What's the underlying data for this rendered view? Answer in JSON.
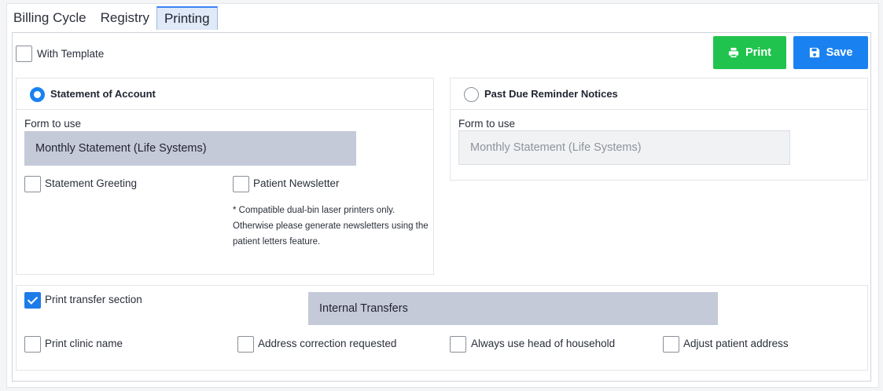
{
  "tabs": [
    {
      "label": "Billing Cycle",
      "active": false
    },
    {
      "label": "Registry",
      "active": false
    },
    {
      "label": "Printing",
      "active": true
    }
  ],
  "toolbar": {
    "with_template_label": "With Template",
    "with_template_checked": false,
    "print_label": "Print",
    "save_label": "Save"
  },
  "statement": {
    "radio_label": "Statement of Account",
    "selected": true,
    "form_label": "Form to use",
    "form_value": "Monthly Statement (Life Systems)",
    "greeting_label": "Statement Greeting",
    "greeting_checked": false,
    "newsletter_label": "Patient Newsletter",
    "newsletter_checked": false,
    "note": "* Compatible dual-bin laser printers only. Otherwise please generate newsletters using the patient letters feature."
  },
  "past_due": {
    "radio_label": "Past Due Reminder Notices",
    "selected": false,
    "form_label": "Form to use",
    "form_value": "Monthly Statement (Life Systems)"
  },
  "bottom": {
    "transfer_label": "Print transfer section",
    "transfer_checked": true,
    "transfer_select_value": "Internal Transfers",
    "clinic_label": "Print clinic name",
    "address_correction_label": "Address correction requested",
    "head_household_label": "Always use head of household",
    "adjust_address_label": "Adjust patient address"
  },
  "colors": {
    "print_button": "#1fc34d",
    "save_button": "#1a82f0",
    "active_select": "#c5cad9",
    "checkbox_checked": "#1e7ce8"
  }
}
